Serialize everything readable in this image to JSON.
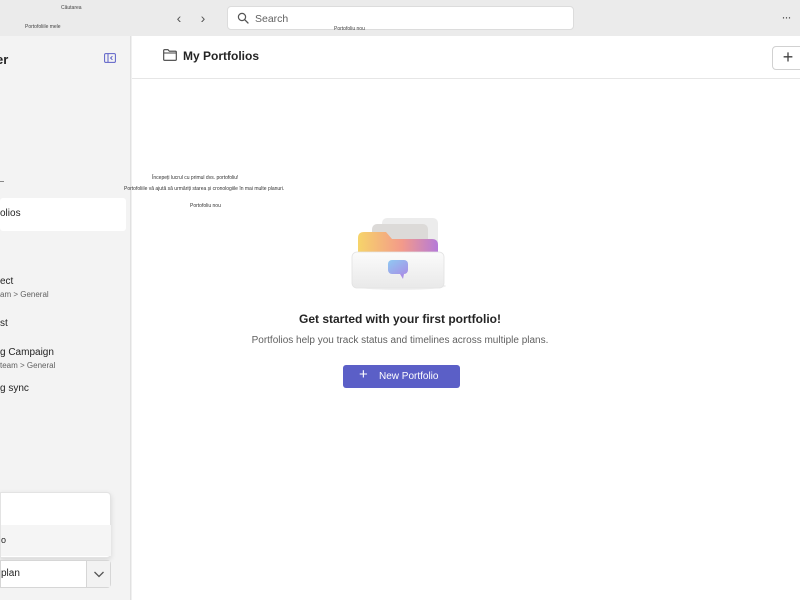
{
  "topbar": {
    "tiny_title": "Căutarea",
    "tiny_subtitle": "Portofoliile mele",
    "tiny_search_hint": "Portofoliu nou",
    "search_placeholder": "Search",
    "back_glyph": "‹",
    "forward_glyph": "›",
    "more_glyph": "···"
  },
  "sidebar": {
    "title": "er",
    "items": [
      {
        "name": "olios",
        "sub": ""
      },
      {
        "name": "ect",
        "sub": "am > General"
      },
      {
        "name": "st",
        "sub": ""
      },
      {
        "name": "g Campaign",
        "sub": "team > General"
      },
      {
        "name": "g sync",
        "sub": ""
      }
    ],
    "popup_items": [
      "",
      "o"
    ],
    "select_value": "plan"
  },
  "main": {
    "title": "My Portfolios",
    "add_glyph": "+",
    "tips": [
      "Începeți lucrul cu primul dvs. portofoliu!",
      "Portofoliile vă ajută să urmăriți starea și cronologiile în mai multe planuri.",
      "Portofoliu nou"
    ],
    "empty_title": "Get started with your first portfolio!",
    "empty_desc": "Portfolios help you track status and timelines across multiple plans.",
    "new_button_label": "New Portfolio",
    "new_button_glyph": "+"
  },
  "colors": {
    "accent": "#5b5fc7",
    "sidebar_bg": "#f3f3f3",
    "topbar_bg": "#ebebeb"
  }
}
